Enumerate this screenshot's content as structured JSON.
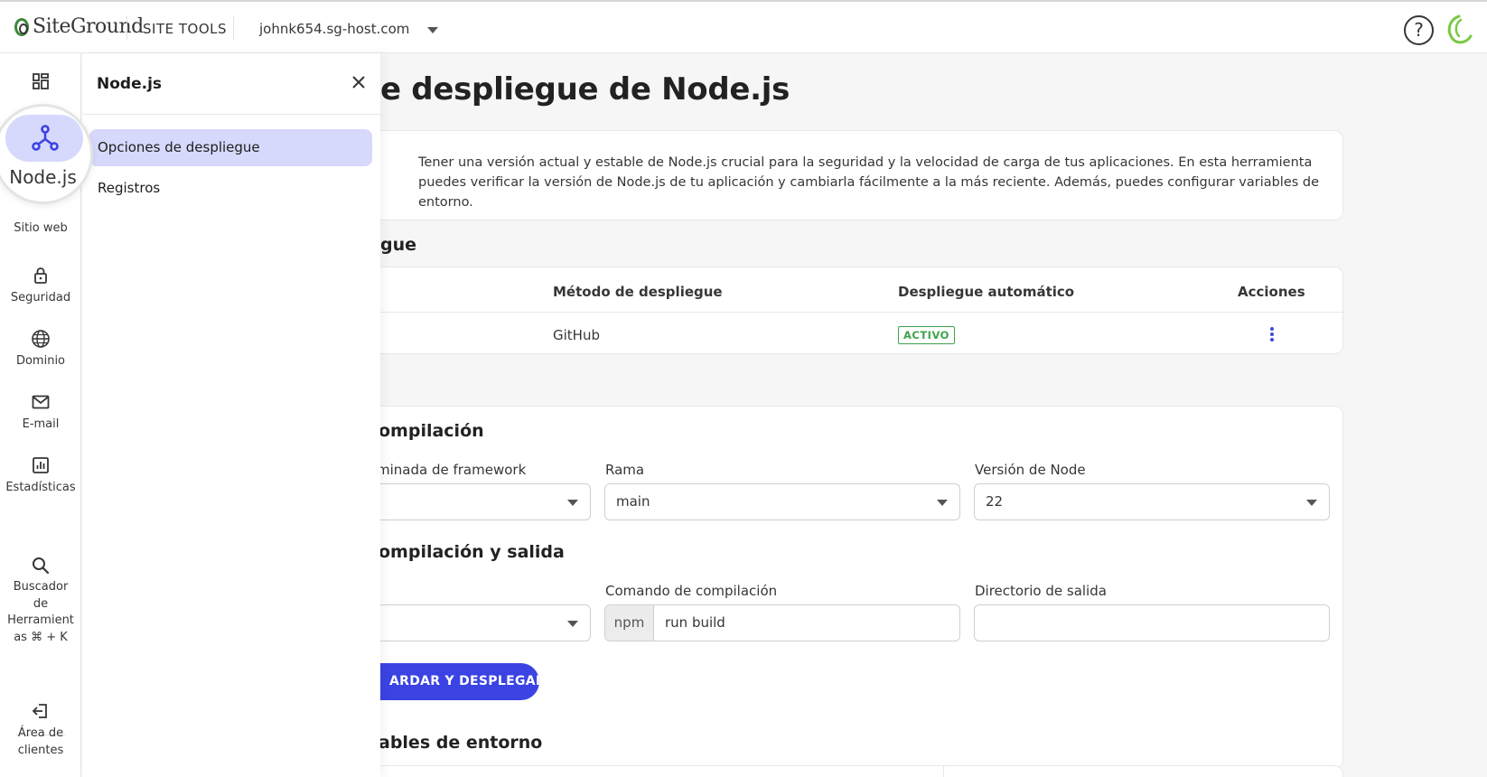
{
  "header": {
    "brand": "SiteGround",
    "site_tools": "SITE TOOLS",
    "domain": "johnk654.sg-host.com",
    "help": "?"
  },
  "leftnav": {
    "items": [
      {
        "label": "Sitio web",
        "icon": "website-icon"
      },
      {
        "label": "Seguridad",
        "icon": "lock-icon"
      },
      {
        "label": "Dominio",
        "icon": "globe-icon"
      },
      {
        "label": "E-mail",
        "icon": "mail-icon"
      },
      {
        "label": "Estadísticas",
        "icon": "stats-icon"
      },
      {
        "label": "Buscador de Herramient as ⌘ + K",
        "icon": "search-icon"
      },
      {
        "label": "Área de clientes",
        "icon": "exit-icon"
      }
    ],
    "magnified_label": "Node.js"
  },
  "panel": {
    "title": "Node.js",
    "items": [
      {
        "label": "Opciones de despliegue",
        "active": true
      },
      {
        "label": "Registros",
        "active": false
      }
    ]
  },
  "main": {
    "title": "e despliegue de Node.js",
    "intro": "Tener una versión actual y estable de Node.js crucial para la seguridad y la velocidad de carga de tus aplicaciones. En esta herramienta puedes verificar la versión de Node.js de tu aplicación y cambiarla fácilmente a la más reciente. Además, puedes configurar variables de entorno.",
    "deploy_section": "gue",
    "table": {
      "headers": [
        "Método de despliegue",
        "Despliegue automático",
        "Acciones"
      ],
      "row": {
        "method": "GitHub",
        "status": "ACTIVO"
      }
    },
    "build_section": "ompilación",
    "framework_label": "minada de framework",
    "branch_label": "Rama",
    "branch_value": "main",
    "node_version_label": "Versión de Node",
    "node_version_value": "22",
    "output_section": "ompilación y salida",
    "build_cmd_label": "Comando de compilación",
    "build_cmd_prefix": "npm",
    "build_cmd_value": "run build",
    "output_dir_label": "Directorio de salida",
    "output_dir_value": "",
    "save_button": "ARDAR Y DESPLEGAR",
    "env_section": "ables de entorno"
  },
  "colors": {
    "accent": "#3b43e3",
    "active_bg": "#d6d9fb",
    "badge_green": "#3fa34d",
    "brand_green": "#7ac943"
  }
}
